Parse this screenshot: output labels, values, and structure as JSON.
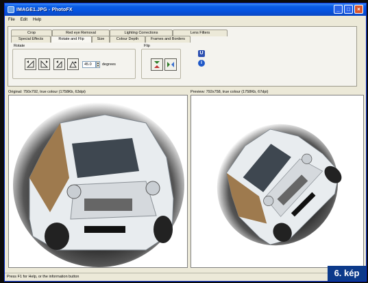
{
  "window": {
    "title": "IMAGE1.JPG - PhotoFX"
  },
  "menu": {
    "items": [
      "File",
      "Edit",
      "Help"
    ]
  },
  "tabs": {
    "row1": [
      "Crop",
      "Red eye Removal",
      "Lighting Corrections",
      "Lens Filters"
    ],
    "row2": [
      "Special Effects",
      "Rotate and Flip",
      "Size",
      "Colour Depth",
      "Frames and Borders"
    ],
    "active": "Rotate and Flip"
  },
  "rotate": {
    "label": "Rotate",
    "angle_value": "45.0",
    "unit_label": "degrees"
  },
  "flip": {
    "label": "Flip"
  },
  "panes": {
    "original_label": "Original: 750x792, true colour (1758Kb, 63dpi)",
    "preview_label": "Preview: 792x758, true colour (1758Kb, 67dpi)"
  },
  "status": {
    "text": "Press F1 for Help, or the information button"
  },
  "caption": {
    "text": "6. kép"
  },
  "colors": {
    "titlebar": "#0a5ce6",
    "caption_tag": "#0c3a8a",
    "close_button": "#d8562c"
  }
}
